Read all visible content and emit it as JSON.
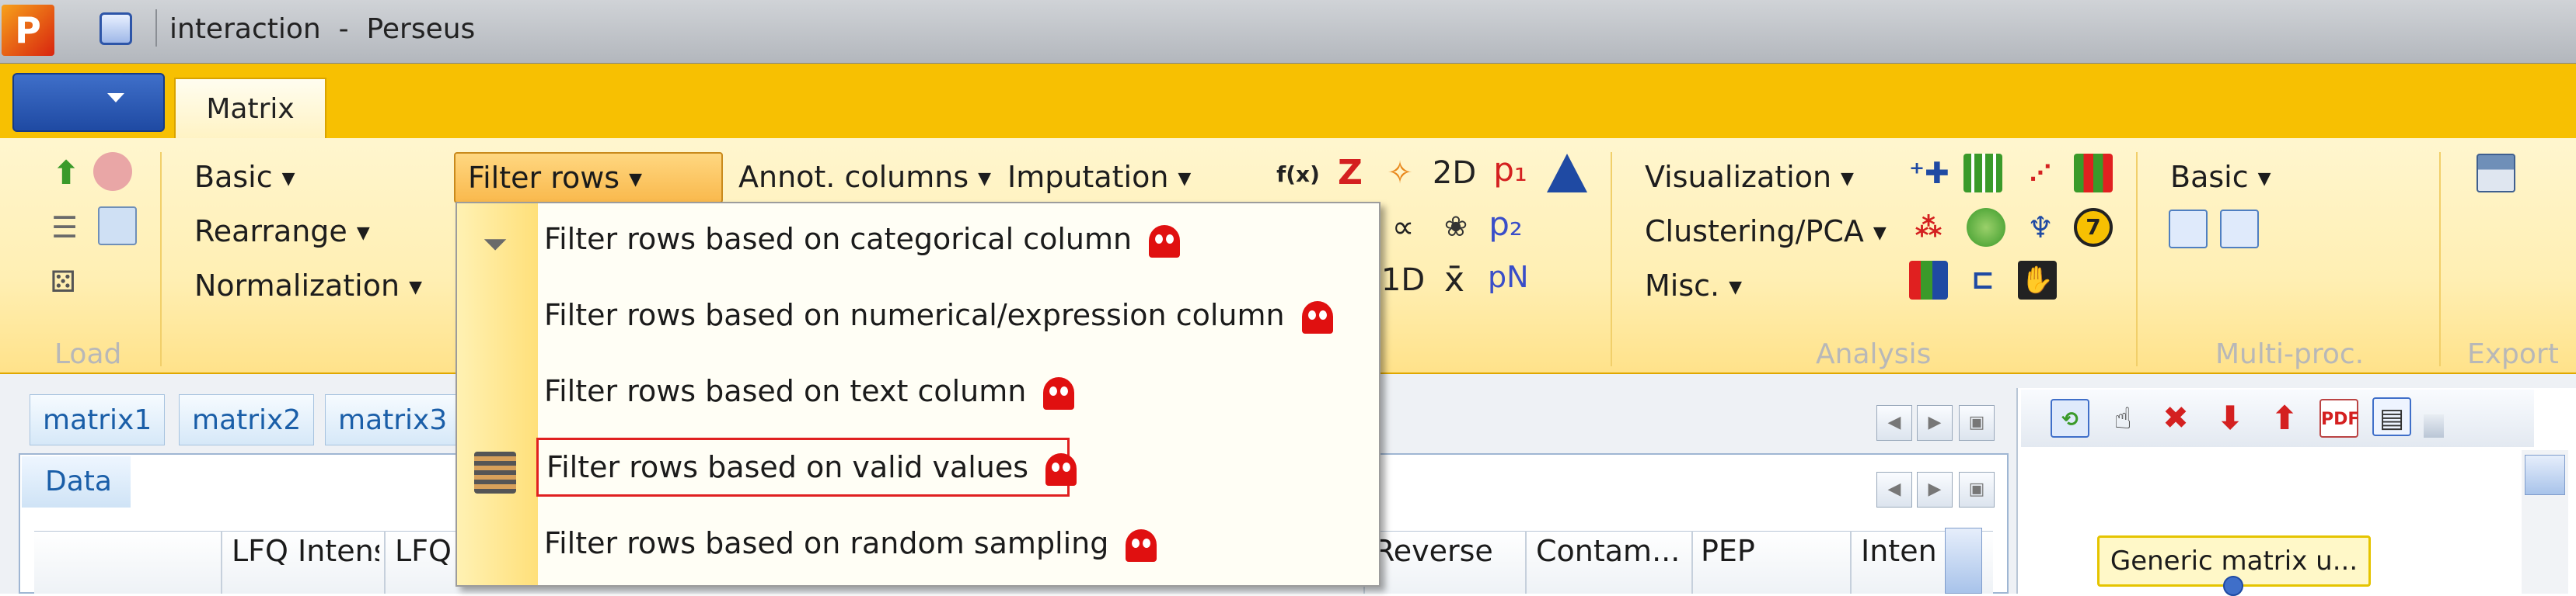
{
  "window": {
    "title": "interaction  -  Perseus",
    "app_icon_letter": "P"
  },
  "ribbon": {
    "tabs": [
      {
        "label": "Matrix"
      }
    ],
    "groups": {
      "load": "Load",
      "analysis": "Analysis",
      "multiproc": "Multi-proc.",
      "export": "Export"
    },
    "processing": {
      "basic": "Basic",
      "rearrange": "Rearrange",
      "normalization": "Normalization",
      "filter_rows": "Filter rows",
      "annot_columns": "Annot. columns",
      "imputation": "Imputation"
    },
    "analysis": {
      "visualization": "Visualization",
      "clustering": "Clustering/PCA",
      "misc": "Misc."
    },
    "multiproc": {
      "basic": "Basic"
    },
    "math_icons": {
      "fx": "f(x)",
      "z": "Z",
      "two_d": "2D",
      "p1": "p₁",
      "p2": "p₂",
      "one_d": "1D",
      "xbar": "x̄",
      "pn": "pN"
    }
  },
  "filter_menu": {
    "items": [
      {
        "label": "Filter rows based on categorical column"
      },
      {
        "label": "Filter rows based on numerical/expression column"
      },
      {
        "label": "Filter rows based on text column"
      },
      {
        "label": "Filter rows based on valid values"
      },
      {
        "label": "Filter rows based on random sampling"
      }
    ]
  },
  "matrix_tabs": [
    {
      "label": "matrix1"
    },
    {
      "label": "matrix2"
    },
    {
      "label": "matrix3"
    }
  ],
  "data_panel": {
    "tab_label": "Data",
    "columns": [
      "LFQ Intensity",
      "LFQ Inten...",
      "Reverse",
      "Contam...",
      "PEP",
      "Inten"
    ]
  },
  "workflow": {
    "node_label": "Generic matrix u..."
  },
  "colors": {
    "ribbon_gold": "#f7c002",
    "highlight_red": "#e02020",
    "link_blue": "#1a5ea8"
  }
}
